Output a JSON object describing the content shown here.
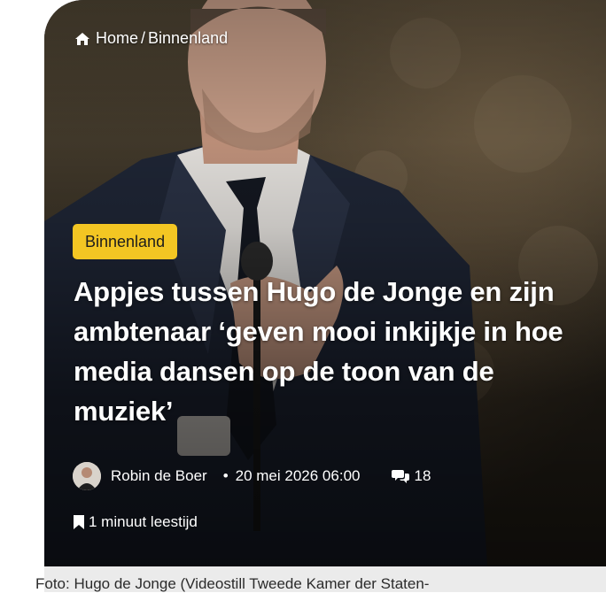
{
  "breadcrumb": {
    "home_label": "Home",
    "separator": "/",
    "section_label": "Binnenland"
  },
  "article": {
    "category": "Binnenland",
    "headline": "Appjes tussen Hugo de Jonge en zijn ambtenaar ‘geven mooi inkijkje in hoe media dansen op de toon van de muziek’",
    "author": "Robin de Boer",
    "date_separator": "•",
    "date": "20 mei 2026 06:00",
    "comment_count": "18",
    "read_time": "1 minuut leestijd",
    "photo_caption": "Foto: Hugo de Jonge (Videostill Tweede Kamer der Staten-"
  },
  "icons": {
    "home": "home-icon",
    "comments": "speech-bubbles-icon",
    "bookmark": "bookmark-icon"
  },
  "colors": {
    "badge_background": "#f3c623",
    "headline_text": "#ffffff",
    "caption_background": "#ebebeb"
  }
}
